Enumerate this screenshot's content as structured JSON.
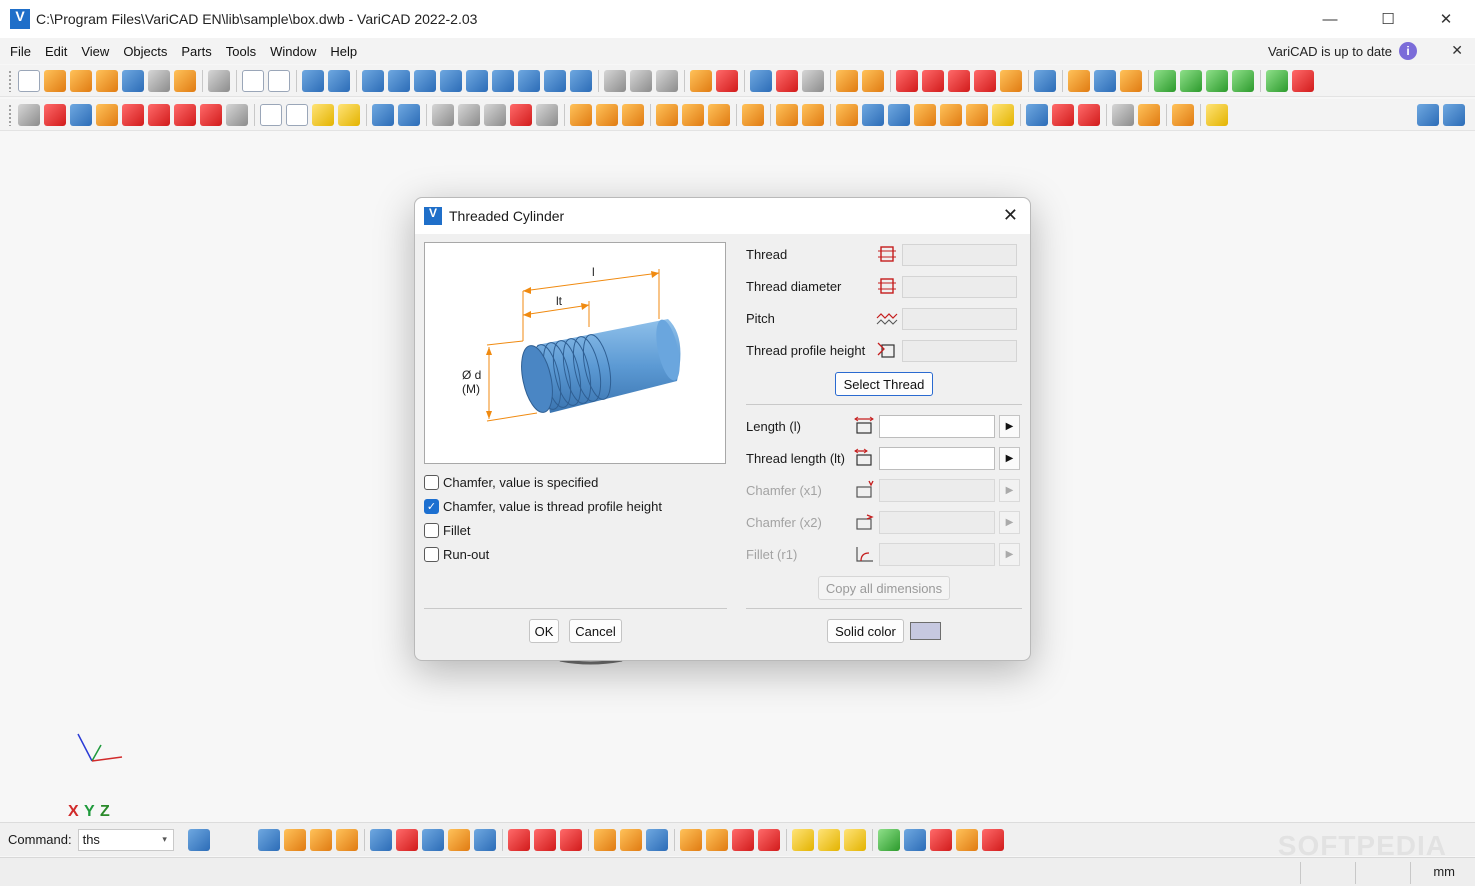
{
  "window": {
    "title": "C:\\Program Files\\VariCAD EN\\lib\\sample\\box.dwb - VariCAD 2022-2.03",
    "logo_letter": "V",
    "controls": {
      "minimize": "—",
      "maximize": "☐",
      "close": "✕"
    }
  },
  "menu": {
    "items": [
      "File",
      "Edit",
      "View",
      "Objects",
      "Parts",
      "Tools",
      "Window",
      "Help"
    ],
    "update_note": "VariCAD is up to date",
    "info_glyph": "i",
    "close_glyph": "✕"
  },
  "axes": {
    "x": "X",
    "y": "Y",
    "z": "Z"
  },
  "command": {
    "label": "Command:",
    "value": "ths",
    "dropdown_glyph": "▾"
  },
  "status": {
    "units": "mm"
  },
  "watermark": "SOFTPEDIA",
  "dialog": {
    "title": "Threaded Cylinder",
    "logo_letter": "V",
    "close_glyph": "✕",
    "preview": {
      "label_l": "l",
      "label_lt": "lt",
      "label_d": "Ø d",
      "label_m": "(M)"
    },
    "options": [
      {
        "label": "Chamfer, value is specified",
        "checked": false
      },
      {
        "label": "Chamfer, value is thread profile height",
        "checked": true
      },
      {
        "label": "Fillet",
        "checked": false
      },
      {
        "label": "Run-out",
        "checked": false
      }
    ],
    "check_glyph": "✓",
    "thread_fields": {
      "thread": "Thread",
      "thread_diameter": "Thread diameter",
      "pitch": "Pitch",
      "thread_profile_height": "Thread profile height"
    },
    "select_thread": "Select Thread",
    "dims": {
      "length": "Length (l)",
      "thread_length": "Thread length (lt)",
      "chamfer_x1": "Chamfer (x1)",
      "chamfer_x2": "Chamfer (x2)",
      "fillet_r1": "Fillet (r1)"
    },
    "arrow_glyph": "▶",
    "copy_all": "Copy all dimensions",
    "ok": "OK",
    "cancel": "Cancel",
    "solid_color": "Solid color",
    "swatch_color": "#c6c8e0"
  },
  "icons": {
    "app": "varicad-logo-icon",
    "info": "info-icon"
  }
}
